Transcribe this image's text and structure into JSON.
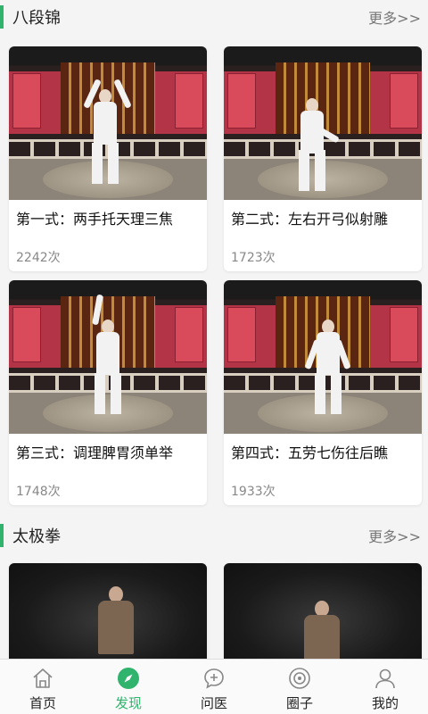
{
  "sections": [
    {
      "title": "八段锦",
      "more": "更多>>",
      "items": [
        {
          "title": "第一式：两手托天理三焦",
          "count": "2242次"
        },
        {
          "title": "第二式：左右开弓似射雕",
          "count": "1723次"
        },
        {
          "title": "第三式：调理脾胃须单举",
          "count": "1748次"
        },
        {
          "title": "第四式：五劳七伤往后瞧",
          "count": "1933次"
        }
      ]
    },
    {
      "title": "太极拳",
      "more": "更多>>"
    }
  ],
  "nav": [
    {
      "label": "首页",
      "icon": "home-icon"
    },
    {
      "label": "发现",
      "icon": "compass-icon",
      "active": true
    },
    {
      "label": "问医",
      "icon": "chat-plus-icon"
    },
    {
      "label": "圈子",
      "icon": "circle-icon"
    },
    {
      "label": "我的",
      "icon": "user-icon"
    }
  ],
  "colors": {
    "accent": "#2fb36d",
    "background": "#f4f4f4"
  }
}
